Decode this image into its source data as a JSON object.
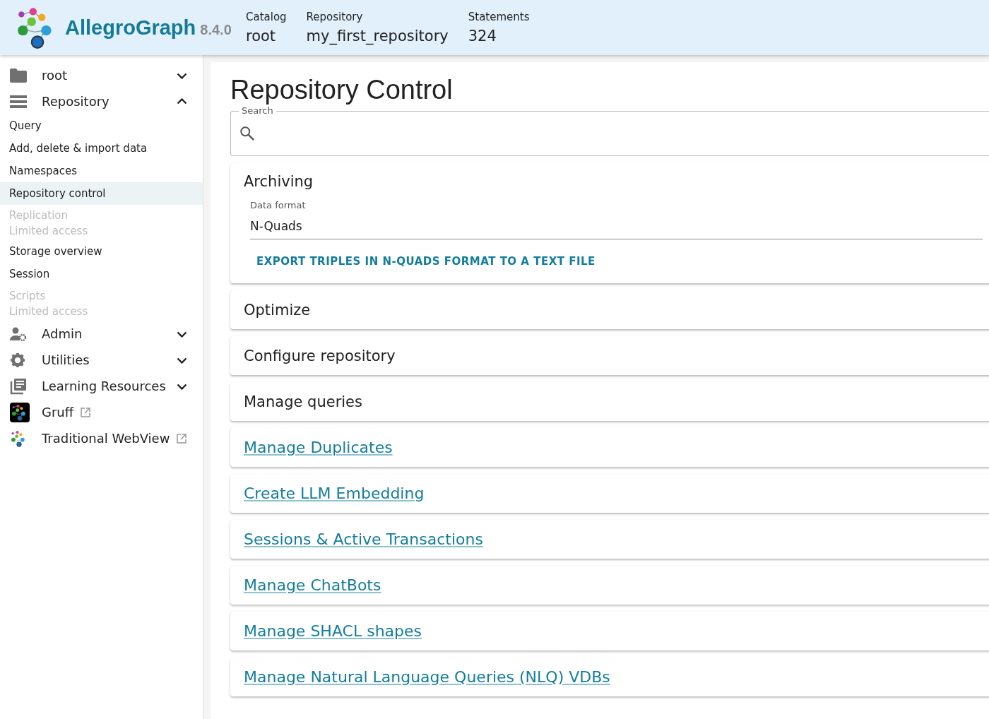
{
  "header": {
    "product": "AllegroGraph",
    "version": "8.4.0",
    "fields": [
      {
        "label": "Catalog",
        "value": "root"
      },
      {
        "label": "Repository",
        "value": "my_first_repository"
      },
      {
        "label": "Statements",
        "value": "324"
      }
    ]
  },
  "sidebar": {
    "items": [
      {
        "kind": "group",
        "label": "root",
        "expanded": false
      },
      {
        "kind": "group",
        "label": "Repository",
        "expanded": true
      },
      {
        "kind": "item",
        "label": "Query",
        "selected": false
      },
      {
        "kind": "item",
        "label": "Add, delete & import data",
        "selected": false
      },
      {
        "kind": "item",
        "label": "Namespaces",
        "selected": false
      },
      {
        "kind": "item",
        "label": "Repository control",
        "selected": true
      },
      {
        "kind": "limited",
        "label": "Replication",
        "note": "Limited access"
      },
      {
        "kind": "item",
        "label": "Storage overview",
        "selected": false
      },
      {
        "kind": "item",
        "label": "Session",
        "selected": false
      },
      {
        "kind": "limited",
        "label": "Scripts",
        "note": "Limited access"
      },
      {
        "kind": "group",
        "label": "Admin",
        "expanded": false
      },
      {
        "kind": "group",
        "label": "Utilities",
        "expanded": false
      },
      {
        "kind": "group",
        "label": "Learning Resources",
        "expanded": false
      },
      {
        "kind": "external",
        "label": "Gruff"
      },
      {
        "kind": "external",
        "label": "Traditional WebView"
      }
    ]
  },
  "main": {
    "title": "Repository Control",
    "search": {
      "label": "Search"
    },
    "sections": [
      {
        "kind": "expanded",
        "title": "Archiving",
        "field_label": "Data format",
        "field_value": "N-Quads",
        "action": "EXPORT TRIPLES IN N-QUADS FORMAT TO A TEXT FILE"
      },
      {
        "kind": "panel",
        "title": "Optimize"
      },
      {
        "kind": "panel",
        "title": "Configure repository"
      },
      {
        "kind": "panel",
        "title": "Manage queries"
      },
      {
        "kind": "link",
        "title": "Manage Duplicates"
      },
      {
        "kind": "link",
        "title": "Create LLM Embedding"
      },
      {
        "kind": "link",
        "title": "Sessions & Active Transactions"
      },
      {
        "kind": "link",
        "title": "Manage ChatBots"
      },
      {
        "kind": "link",
        "title": "Manage SHACL shapes"
      },
      {
        "kind": "link",
        "title": "Manage Natural Language Queries (NLQ) VDBs"
      }
    ]
  }
}
